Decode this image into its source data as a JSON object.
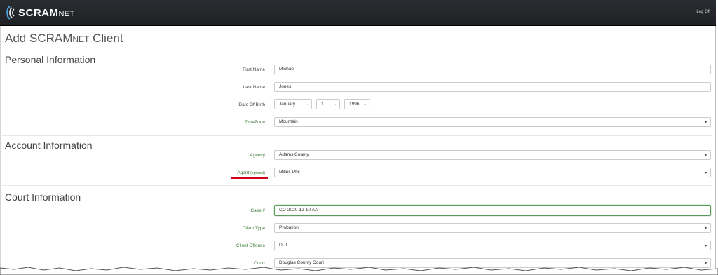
{
  "app": {
    "logo_main": "SCRAM",
    "logo_sub": "NET",
    "logoff": "Log Off"
  },
  "page": {
    "title_main": "Add SCRAM",
    "title_sub": "NET",
    "title_end": " Client"
  },
  "personal": {
    "heading": "Personal Information",
    "first_name_label": "First Name",
    "first_name": "Michael",
    "last_name_label": "Last Name",
    "last_name": "Jones",
    "dob_label": "Date Of Birth",
    "dob_month": "January",
    "dob_day": "1",
    "dob_year": "1996",
    "timezone_label": "TimeZone",
    "timezone": "Mountain"
  },
  "account": {
    "heading": "Account Information",
    "agency_label": "Agency",
    "agency": "Adams County",
    "agent_label": "Agent",
    "agent_optional": "(optional)",
    "agent": "Miller, Phil"
  },
  "court": {
    "heading": "Court Information",
    "case_label": "Case #",
    "case": "CO-2020-12-10 AA",
    "client_type_label": "Client Type",
    "client_type": "Probation",
    "offense_label": "Client Offense",
    "offense": "DUI",
    "court_label": "Court",
    "court": "Douglas County Court"
  },
  "colors": {
    "topbar": "#1f2124",
    "label_green": "#3c7a3a",
    "annotation_red": "#d0021b"
  },
  "icons": [
    "scram-logo-icon",
    "chevron-down-icon"
  ]
}
